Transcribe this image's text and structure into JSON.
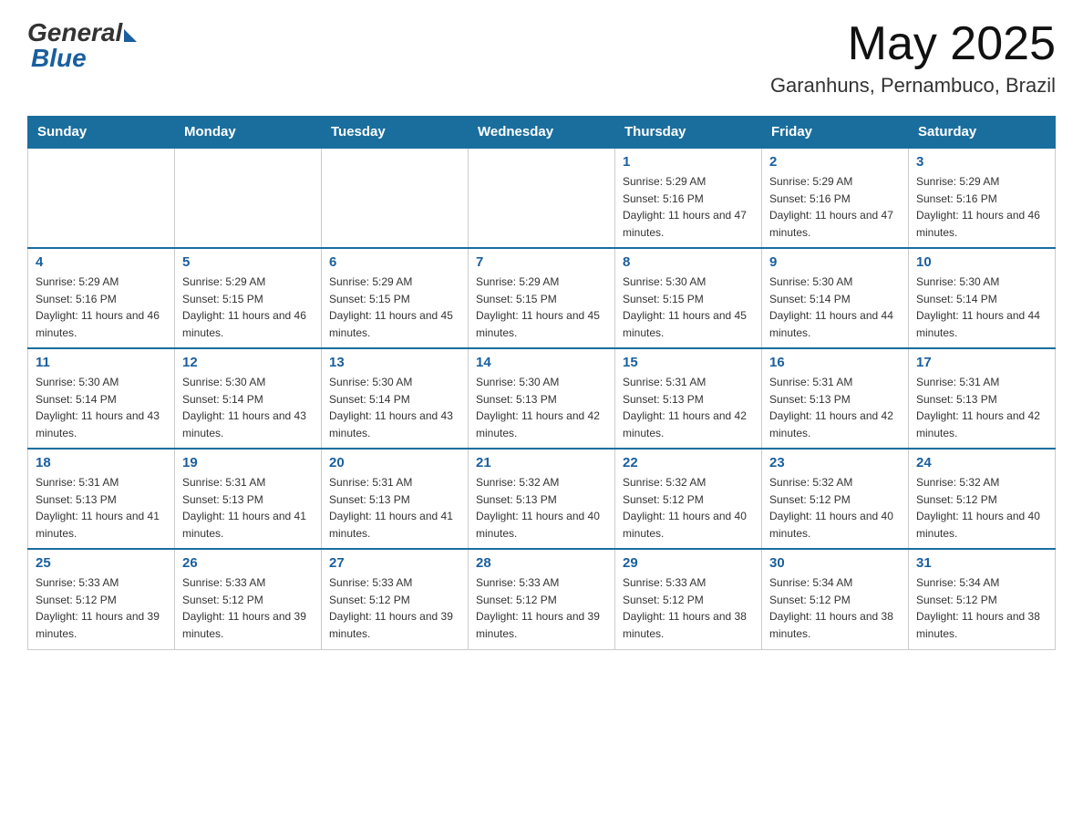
{
  "header": {
    "logo_general": "General",
    "logo_blue": "Blue",
    "month_year": "May 2025",
    "location": "Garanhuns, Pernambuco, Brazil"
  },
  "calendar": {
    "days_of_week": [
      "Sunday",
      "Monday",
      "Tuesday",
      "Wednesday",
      "Thursday",
      "Friday",
      "Saturday"
    ],
    "weeks": [
      [
        {
          "day": "",
          "info": ""
        },
        {
          "day": "",
          "info": ""
        },
        {
          "day": "",
          "info": ""
        },
        {
          "day": "",
          "info": ""
        },
        {
          "day": "1",
          "info": "Sunrise: 5:29 AM\nSunset: 5:16 PM\nDaylight: 11 hours and 47 minutes."
        },
        {
          "day": "2",
          "info": "Sunrise: 5:29 AM\nSunset: 5:16 PM\nDaylight: 11 hours and 47 minutes."
        },
        {
          "day": "3",
          "info": "Sunrise: 5:29 AM\nSunset: 5:16 PM\nDaylight: 11 hours and 46 minutes."
        }
      ],
      [
        {
          "day": "4",
          "info": "Sunrise: 5:29 AM\nSunset: 5:16 PM\nDaylight: 11 hours and 46 minutes."
        },
        {
          "day": "5",
          "info": "Sunrise: 5:29 AM\nSunset: 5:15 PM\nDaylight: 11 hours and 46 minutes."
        },
        {
          "day": "6",
          "info": "Sunrise: 5:29 AM\nSunset: 5:15 PM\nDaylight: 11 hours and 45 minutes."
        },
        {
          "day": "7",
          "info": "Sunrise: 5:29 AM\nSunset: 5:15 PM\nDaylight: 11 hours and 45 minutes."
        },
        {
          "day": "8",
          "info": "Sunrise: 5:30 AM\nSunset: 5:15 PM\nDaylight: 11 hours and 45 minutes."
        },
        {
          "day": "9",
          "info": "Sunrise: 5:30 AM\nSunset: 5:14 PM\nDaylight: 11 hours and 44 minutes."
        },
        {
          "day": "10",
          "info": "Sunrise: 5:30 AM\nSunset: 5:14 PM\nDaylight: 11 hours and 44 minutes."
        }
      ],
      [
        {
          "day": "11",
          "info": "Sunrise: 5:30 AM\nSunset: 5:14 PM\nDaylight: 11 hours and 43 minutes."
        },
        {
          "day": "12",
          "info": "Sunrise: 5:30 AM\nSunset: 5:14 PM\nDaylight: 11 hours and 43 minutes."
        },
        {
          "day": "13",
          "info": "Sunrise: 5:30 AM\nSunset: 5:14 PM\nDaylight: 11 hours and 43 minutes."
        },
        {
          "day": "14",
          "info": "Sunrise: 5:30 AM\nSunset: 5:13 PM\nDaylight: 11 hours and 42 minutes."
        },
        {
          "day": "15",
          "info": "Sunrise: 5:31 AM\nSunset: 5:13 PM\nDaylight: 11 hours and 42 minutes."
        },
        {
          "day": "16",
          "info": "Sunrise: 5:31 AM\nSunset: 5:13 PM\nDaylight: 11 hours and 42 minutes."
        },
        {
          "day": "17",
          "info": "Sunrise: 5:31 AM\nSunset: 5:13 PM\nDaylight: 11 hours and 42 minutes."
        }
      ],
      [
        {
          "day": "18",
          "info": "Sunrise: 5:31 AM\nSunset: 5:13 PM\nDaylight: 11 hours and 41 minutes."
        },
        {
          "day": "19",
          "info": "Sunrise: 5:31 AM\nSunset: 5:13 PM\nDaylight: 11 hours and 41 minutes."
        },
        {
          "day": "20",
          "info": "Sunrise: 5:31 AM\nSunset: 5:13 PM\nDaylight: 11 hours and 41 minutes."
        },
        {
          "day": "21",
          "info": "Sunrise: 5:32 AM\nSunset: 5:13 PM\nDaylight: 11 hours and 40 minutes."
        },
        {
          "day": "22",
          "info": "Sunrise: 5:32 AM\nSunset: 5:12 PM\nDaylight: 11 hours and 40 minutes."
        },
        {
          "day": "23",
          "info": "Sunrise: 5:32 AM\nSunset: 5:12 PM\nDaylight: 11 hours and 40 minutes."
        },
        {
          "day": "24",
          "info": "Sunrise: 5:32 AM\nSunset: 5:12 PM\nDaylight: 11 hours and 40 minutes."
        }
      ],
      [
        {
          "day": "25",
          "info": "Sunrise: 5:33 AM\nSunset: 5:12 PM\nDaylight: 11 hours and 39 minutes."
        },
        {
          "day": "26",
          "info": "Sunrise: 5:33 AM\nSunset: 5:12 PM\nDaylight: 11 hours and 39 minutes."
        },
        {
          "day": "27",
          "info": "Sunrise: 5:33 AM\nSunset: 5:12 PM\nDaylight: 11 hours and 39 minutes."
        },
        {
          "day": "28",
          "info": "Sunrise: 5:33 AM\nSunset: 5:12 PM\nDaylight: 11 hours and 39 minutes."
        },
        {
          "day": "29",
          "info": "Sunrise: 5:33 AM\nSunset: 5:12 PM\nDaylight: 11 hours and 38 minutes."
        },
        {
          "day": "30",
          "info": "Sunrise: 5:34 AM\nSunset: 5:12 PM\nDaylight: 11 hours and 38 minutes."
        },
        {
          "day": "31",
          "info": "Sunrise: 5:34 AM\nSunset: 5:12 PM\nDaylight: 11 hours and 38 minutes."
        }
      ]
    ]
  }
}
